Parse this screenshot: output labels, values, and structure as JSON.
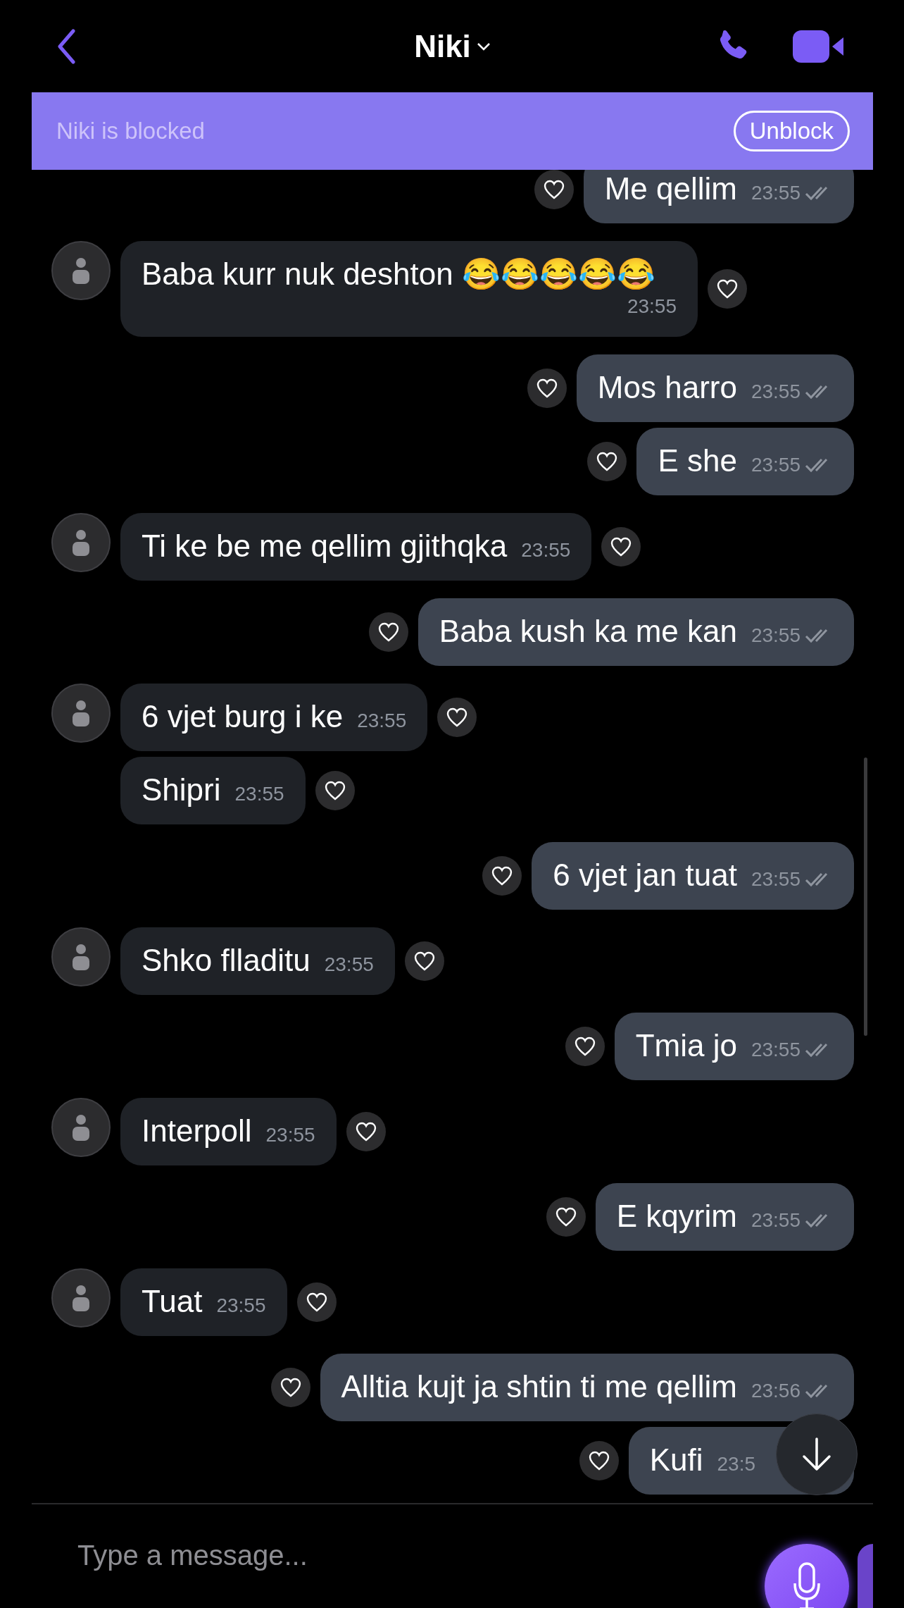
{
  "header": {
    "title": "Niki"
  },
  "banner": {
    "text": "Niki is blocked",
    "button": "Unblock"
  },
  "messages": [
    {
      "kind": "outgoing",
      "text": "Me qellim",
      "time": "23:55"
    },
    {
      "kind": "incoming",
      "text": "Baba kurr nuk deshton 😂😂😂😂😂",
      "time": "23:55"
    },
    {
      "kind": "outgoing",
      "text": "Mos harro",
      "time": "23:55"
    },
    {
      "kind": "outgoing",
      "text": "E she",
      "time": "23:55"
    },
    {
      "kind": "incoming",
      "text": "Ti ke be me qellim gjithqka",
      "time": "23:55"
    },
    {
      "kind": "outgoing",
      "text": "Baba kush ka me kan",
      "time": "23:55"
    },
    {
      "kind": "incoming",
      "text": "6 vjet burg i ke",
      "time": "23:55"
    },
    {
      "kind": "incoming",
      "text": "Shipri",
      "time": "23:55"
    },
    {
      "kind": "outgoing",
      "text": "6 vjet jan tuat",
      "time": "23:55"
    },
    {
      "kind": "incoming",
      "text": "Shko flladitu",
      "time": "23:55"
    },
    {
      "kind": "outgoing",
      "text": "Tmia jo",
      "time": "23:55"
    },
    {
      "kind": "incoming",
      "text": "Interpoll",
      "time": "23:55"
    },
    {
      "kind": "outgoing",
      "text": "E kqyrim",
      "time": "23:55"
    },
    {
      "kind": "incoming",
      "text": "Tuat",
      "time": "23:55"
    },
    {
      "kind": "outgoing",
      "text": "Alltia kujt ja shtin ti me qellim",
      "time": "23:56"
    },
    {
      "kind": "outgoing",
      "text": "Kufi",
      "time": "23:5"
    }
  ],
  "composer": {
    "placeholder": "Type a message..."
  }
}
